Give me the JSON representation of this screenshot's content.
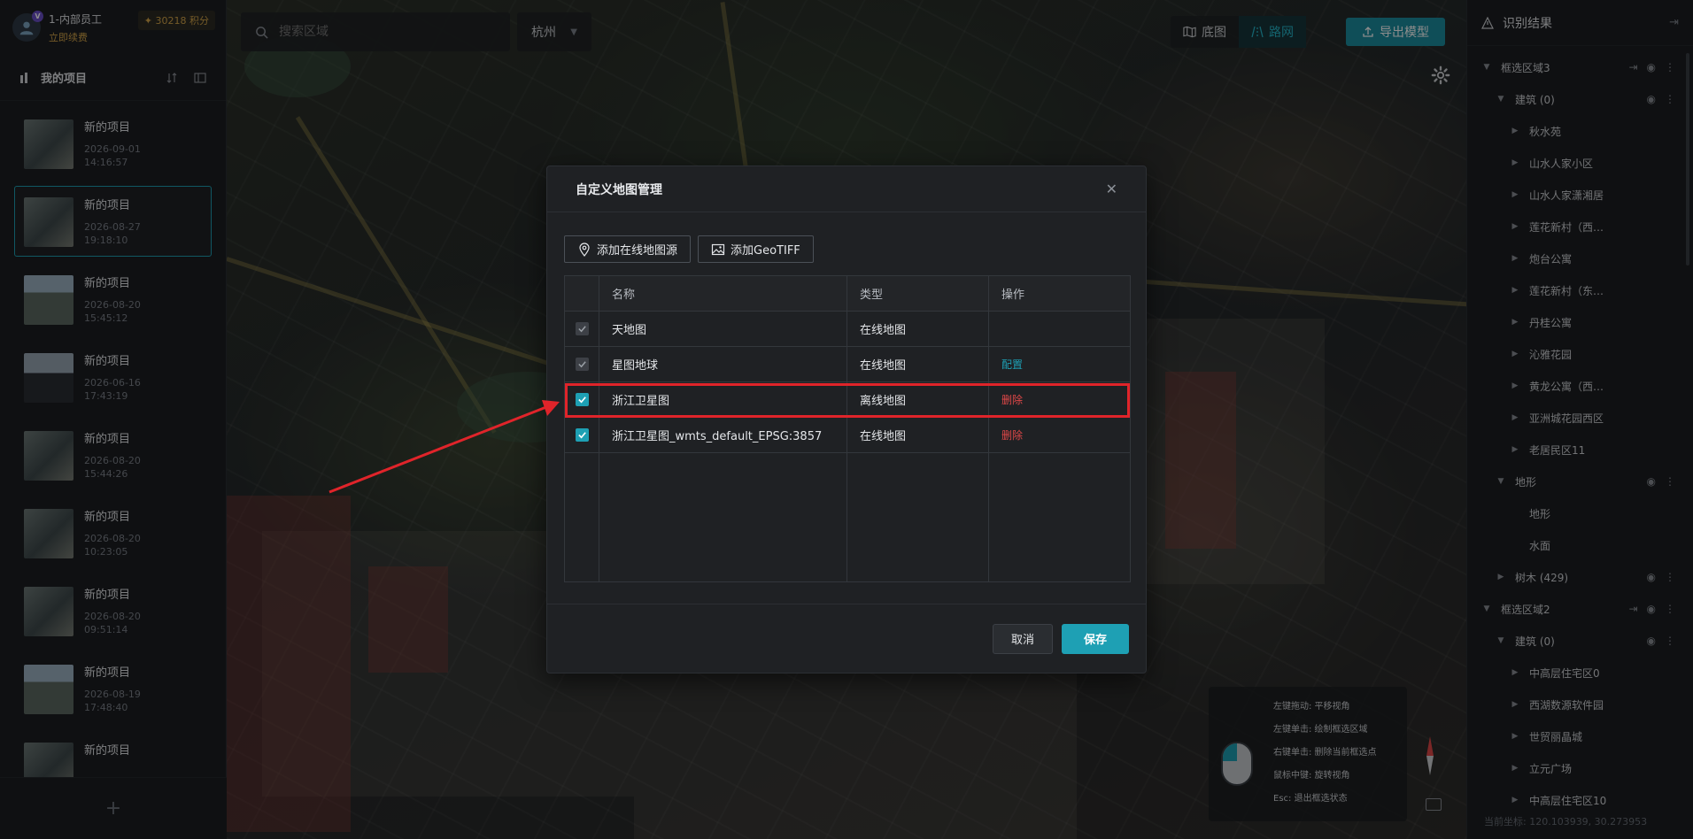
{
  "user": {
    "name": "1-内部员工",
    "renew": "立即续费",
    "badge": "V",
    "points": "✦ 30218 积分"
  },
  "projects": {
    "header": "我的项目",
    "items": [
      {
        "name": "新的项目",
        "date": "2026-09-01",
        "time": "14:16:57"
      },
      {
        "name": "新的项目",
        "date": "2026-08-27",
        "time": "19:18:10"
      },
      {
        "name": "新的项目",
        "date": "2026-08-20",
        "time": "15:45:12"
      },
      {
        "name": "新的项目",
        "date": "2026-06-16",
        "time": "17:43:19"
      },
      {
        "name": "新的项目",
        "date": "2026-08-20",
        "time": "15:44:26"
      },
      {
        "name": "新的项目",
        "date": "2026-08-20",
        "time": "10:23:05"
      },
      {
        "name": "新的项目",
        "date": "2026-08-20",
        "time": "09:51:14"
      },
      {
        "name": "新的项目",
        "date": "2026-08-19",
        "time": "17:48:40"
      },
      {
        "name": "新的项目",
        "date": "",
        "time": ""
      }
    ],
    "add": "+"
  },
  "search": {
    "placeholder": "搜索区域"
  },
  "city": {
    "value": "杭州"
  },
  "layers": {
    "base": "底图",
    "road": "路网"
  },
  "export": "导出模型",
  "results": {
    "title": "识别结果",
    "tree": [
      {
        "level": 0,
        "arrow": "▼",
        "label": "框选区域3",
        "acts": true
      },
      {
        "level": 1,
        "arrow": "▼",
        "label": "建筑 (0)",
        "acts": "eye"
      },
      {
        "level": 2,
        "arrow": "▶",
        "label": "秋水苑"
      },
      {
        "level": 2,
        "arrow": "▶",
        "label": "山水人家小区"
      },
      {
        "level": 2,
        "arrow": "▶",
        "label": "山水人家潇湘居"
      },
      {
        "level": 2,
        "arrow": "▶",
        "label": "莲花新村（西…"
      },
      {
        "level": 2,
        "arrow": "▶",
        "label": "炮台公寓"
      },
      {
        "level": 2,
        "arrow": "▶",
        "label": "莲花新村（东…"
      },
      {
        "level": 2,
        "arrow": "▶",
        "label": "丹桂公寓"
      },
      {
        "level": 2,
        "arrow": "▶",
        "label": "沁雅花园"
      },
      {
        "level": 2,
        "arrow": "▶",
        "label": "黄龙公寓（西…"
      },
      {
        "level": 2,
        "arrow": "▶",
        "label": "亚洲城花园西区"
      },
      {
        "level": 2,
        "arrow": "▶",
        "label": "老居民区11"
      },
      {
        "level": 1,
        "arrow": "▼",
        "label": "地形",
        "acts": "eye"
      },
      {
        "level": 2,
        "arrow": "",
        "label": "地形"
      },
      {
        "level": 2,
        "arrow": "",
        "label": "水面"
      },
      {
        "level": 1,
        "arrow": "▶",
        "label": "树木 (429)",
        "acts": "eye"
      },
      {
        "level": 0,
        "arrow": "▼",
        "label": "框选区域2",
        "acts": true
      },
      {
        "level": 1,
        "arrow": "▼",
        "label": "建筑 (0)",
        "acts": "eye"
      },
      {
        "level": 2,
        "arrow": "▶",
        "label": "中高层住宅区0"
      },
      {
        "level": 2,
        "arrow": "▶",
        "label": "西湖数源软件园"
      },
      {
        "level": 2,
        "arrow": "▶",
        "label": "世贸丽晶城"
      },
      {
        "level": 2,
        "arrow": "▶",
        "label": "立元广场"
      },
      {
        "level": 2,
        "arrow": "▶",
        "label": "中高层住宅区10"
      }
    ],
    "coords": "当前坐标: 120.103939, 30.273953"
  },
  "hint": {
    "lines": [
      "左键拖动: 平移视角",
      "左键单击: 绘制框选区域",
      "右键单击: 删除当前框选点",
      "鼠标中键: 旋转视角",
      "Esc: 退出框选状态"
    ]
  },
  "modal": {
    "title": "自定义地图管理",
    "add_online": "添加在线地图源",
    "add_geotiff": "添加GeoTIFF",
    "columns": {
      "name": "名称",
      "type": "类型",
      "ops": "操作"
    },
    "rows": [
      {
        "checked": "grey",
        "name": "天地图",
        "type": "在线地图",
        "op": "",
        "op_kind": ""
      },
      {
        "checked": "grey",
        "name": "星图地球",
        "type": "在线地图",
        "op": "配置",
        "op_kind": "cfg"
      },
      {
        "checked": "teal",
        "name": "浙江卫星图",
        "type": "离线地图",
        "op": "删除",
        "op_kind": "del"
      },
      {
        "checked": "teal",
        "name": "浙江卫星图_wmts_default_EPSG:3857",
        "type": "在线地图",
        "op": "删除",
        "op_kind": "del"
      }
    ],
    "cancel": "取消",
    "save": "保存"
  },
  "colors": {
    "accent": "#1ea0b4",
    "danger": "#e04848",
    "annotation": "#e0242a",
    "gold": "#d6a64a"
  }
}
